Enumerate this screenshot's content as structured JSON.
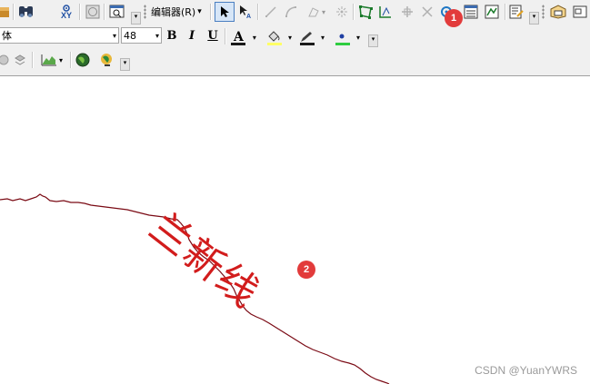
{
  "toolbar": {
    "editor_menu_label": "编辑器(R)",
    "editor_menu_arrow": "▾",
    "xy_label": "XY",
    "font_name": "体",
    "font_size": "48",
    "bold_label": "B",
    "italic_label": "I",
    "underline_label": "U",
    "font_color_label": "A",
    "arrow_glyph": "▾",
    "colors": {
      "font_color": "#1a1a1a",
      "fill_color": "#ffff66",
      "line_color": "#1a1a1a",
      "marker_color": "#2ecc40",
      "select_highlight": "#d7e6f7"
    }
  },
  "annotations": {
    "badge1": "1",
    "badge2": "2",
    "badge_color": "#e23b3b"
  },
  "map": {
    "label_text": "兰新线",
    "label_color": "#d21c1c",
    "line_color": "#7a0a14"
  },
  "watermark": "CSDN @YuanYWRS"
}
